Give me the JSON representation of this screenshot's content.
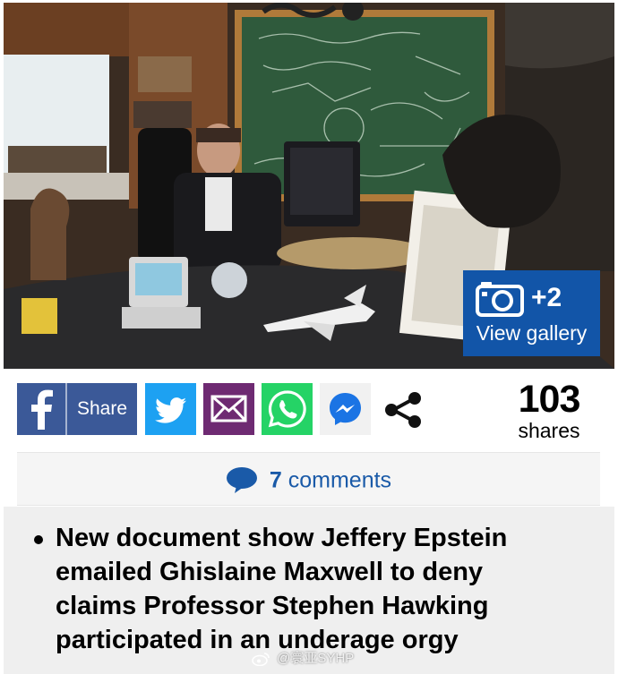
{
  "photo": {
    "description_icon": "photo-icon"
  },
  "gallery": {
    "count": "+2",
    "label": "View gallery",
    "icon": "camera-icon",
    "color": "#1255a8"
  },
  "share": {
    "facebook_label": "Share",
    "facebook_color": "#3b5998",
    "twitter_color": "#1da1f2",
    "email_color": "#6e2a72",
    "whatsapp_color": "#25d366",
    "messenger_color": "#1b74e4",
    "icons": [
      "facebook-icon",
      "twitter-icon",
      "email-icon",
      "whatsapp-icon",
      "messenger-icon",
      "share-icon"
    ]
  },
  "shares": {
    "count": "103",
    "label": "shares"
  },
  "comments": {
    "count": "7",
    "label": "comments",
    "icon": "comment-bubble-icon"
  },
  "headline": {
    "bullet": "New document show Jeffery Epstein emailed Ghislaine Maxwell to deny claims Professor Stephen Hawking participated in an underage orgy"
  },
  "watermark": {
    "text": "@寰亚SYHP"
  }
}
